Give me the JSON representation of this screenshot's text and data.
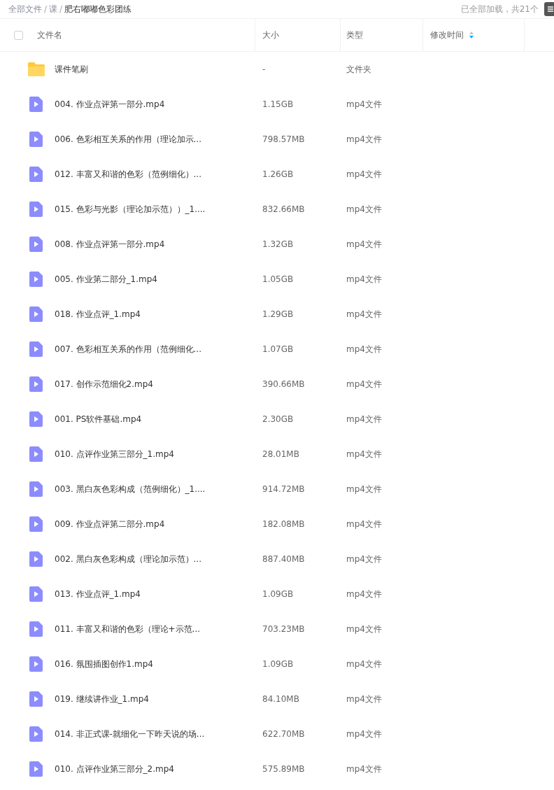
{
  "breadcrumb": [
    {
      "label": "全部文件",
      "current": false
    },
    {
      "label": "课",
      "current": false
    },
    {
      "label": "肥右嘟嘟色彩团练",
      "current": true
    }
  ],
  "breadcrumb_separator": "/",
  "load_status": "已全部加载，共21个",
  "table": {
    "select_all_checked": false,
    "columns": [
      "文件名",
      "大小",
      "类型",
      "修改时间"
    ],
    "rows": [
      {
        "kind": "folder",
        "name": "课件笔刷",
        "size": "-",
        "type": "文件夹"
      },
      {
        "kind": "video",
        "name": "004. 作业点评第一部分.mp4",
        "size": "1.15GB",
        "type": "mp4文件"
      },
      {
        "kind": "video",
        "name": "006. 色彩相互关系的作用（理论加示...",
        "size": "798.57MB",
        "type": "mp4文件"
      },
      {
        "kind": "video",
        "name": "012. 丰富又和谐的色彩（范例细化）...",
        "size": "1.26GB",
        "type": "mp4文件"
      },
      {
        "kind": "video",
        "name": "015. 色彩与光影（理论加示范））_1....",
        "size": "832.66MB",
        "type": "mp4文件"
      },
      {
        "kind": "video",
        "name": "008. 作业点评第一部分.mp4",
        "size": "1.32GB",
        "type": "mp4文件"
      },
      {
        "kind": "video",
        "name": "005. 作业第二部分_1.mp4",
        "size": "1.05GB",
        "type": "mp4文件"
      },
      {
        "kind": "video",
        "name": "018. 作业点评_1.mp4",
        "size": "1.29GB",
        "type": "mp4文件"
      },
      {
        "kind": "video",
        "name": "007. 色彩相互关系的作用（范例细化...",
        "size": "1.07GB",
        "type": "mp4文件"
      },
      {
        "kind": "video",
        "name": "017. 创作示范细化2.mp4",
        "size": "390.66MB",
        "type": "mp4文件"
      },
      {
        "kind": "video",
        "name": "001. PS软件基础.mp4",
        "size": "2.30GB",
        "type": "mp4文件"
      },
      {
        "kind": "video",
        "name": "010. 点评作业第三部分_1.mp4",
        "size": "28.01MB",
        "type": "mp4文件"
      },
      {
        "kind": "video",
        "name": "003. 黑白灰色彩构成（范例细化）_1....",
        "size": "914.72MB",
        "type": "mp4文件"
      },
      {
        "kind": "video",
        "name": "009. 作业点评第二部分.mp4",
        "size": "182.08MB",
        "type": "mp4文件"
      },
      {
        "kind": "video",
        "name": "002. 黑白灰色彩构成（理论加示范）...",
        "size": "887.40MB",
        "type": "mp4文件"
      },
      {
        "kind": "video",
        "name": "013. 作业点评_1.mp4",
        "size": "1.09GB",
        "type": "mp4文件"
      },
      {
        "kind": "video",
        "name": "011. 丰富又和谐的色彩（理论+示范...",
        "size": "703.23MB",
        "type": "mp4文件"
      },
      {
        "kind": "video",
        "name": "016. 氛围插图创作1.mp4",
        "size": "1.09GB",
        "type": "mp4文件"
      },
      {
        "kind": "video",
        "name": "019. 继续讲作业_1.mp4",
        "size": "84.10MB",
        "type": "mp4文件"
      },
      {
        "kind": "video",
        "name": "014. 非正式课-就细化一下昨天说的场...",
        "size": "622.70MB",
        "type": "mp4文件"
      },
      {
        "kind": "video",
        "name": "010. 点评作业第三部分_2.mp4",
        "size": "575.89MB",
        "type": "mp4文件"
      }
    ]
  }
}
